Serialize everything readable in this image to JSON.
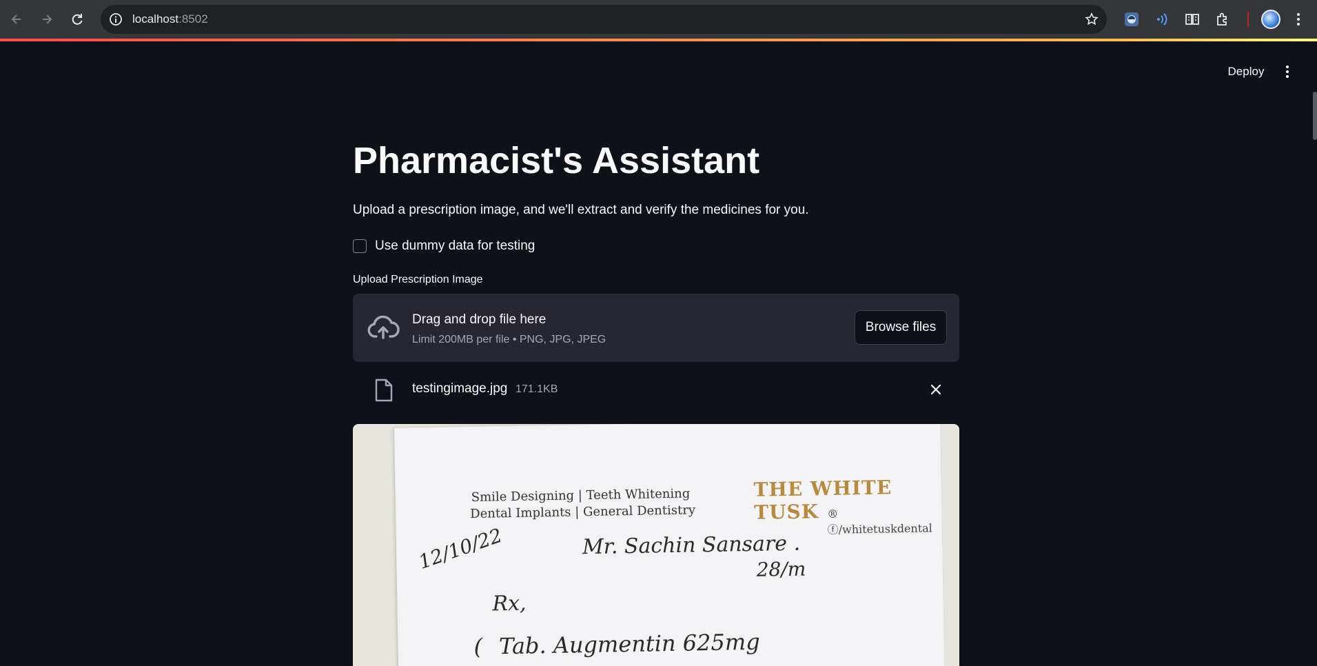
{
  "browser": {
    "url_host": "localhost",
    "url_port": ":8502"
  },
  "header": {
    "deploy_label": "Deploy"
  },
  "main": {
    "title": "Pharmacist's Assistant",
    "subtitle": "Upload a prescription image, and we'll extract and verify the medicines for you.",
    "dummy_checkbox": {
      "label": "Use dummy data for testing",
      "checked": false
    },
    "upload_label": "Upload Prescription Image",
    "dropzone": {
      "title": "Drag and drop file here",
      "limit": "Limit 200MB per file • PNG, JPG, JPEG",
      "browse_label": "Browse files"
    },
    "file": {
      "name": "testingimage.jpg",
      "size": "171.1KB"
    }
  },
  "prescription": {
    "tagline_1": "Smile Designing | Teeth Whitening",
    "tagline_2": "Dental Implants | General Dentistry",
    "brand": "THE WHITE TUSK",
    "handle": "/whitetuskdental",
    "date": "12/10/22",
    "patient": "Mr. Sachin Sansare .",
    "age": "28/m",
    "rx": "Rx,",
    "medicine_1": "Tab. Augmentin 625mg"
  },
  "colors": {
    "background": "#0e1117",
    "surface": "#262730",
    "text": "#fafafa",
    "muted": "#a3a8b8",
    "accent_gradient_start": "#ff4b4b",
    "accent_gradient_end": "#fffd80",
    "brand_gold": "#b88a3e"
  }
}
